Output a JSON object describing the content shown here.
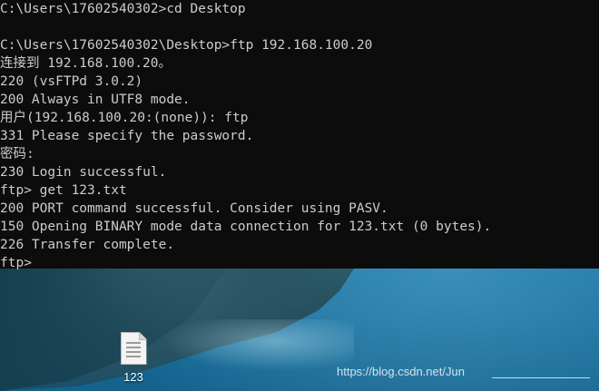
{
  "terminal": {
    "lines": [
      "C:\\Users\\17602540302>cd Desktop",
      "",
      "C:\\Users\\17602540302\\Desktop>ftp 192.168.100.20",
      "连接到 192.168.100.20。",
      "220 (vsFTPd 3.0.2)",
      "200 Always in UTF8 mode.",
      "用户(192.168.100.20:(none)): ftp",
      "331 Please specify the password.",
      "密码:",
      "230 Login successful.",
      "ftp> get 123.txt",
      "200 PORT command successful. Consider using PASV.",
      "150 Opening BINARY mode data connection for 123.txt (0 bytes).",
      "226 Transfer complete.",
      "ftp>"
    ]
  },
  "desktop": {
    "icons": [
      {
        "label": "123",
        "icon": "text-file-icon"
      }
    ],
    "watermark": "https://blog.csdn.net/Jun"
  }
}
